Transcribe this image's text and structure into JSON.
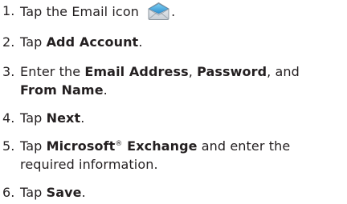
{
  "steps": [
    {
      "number": "1.",
      "parts": [
        {
          "text": "Tap the Email icon ",
          "bold": false
        },
        {
          "icon": "email-envelope-icon"
        },
        {
          "text": ".",
          "bold": false
        }
      ]
    },
    {
      "number": "2.",
      "parts": [
        {
          "text": "Tap ",
          "bold": false
        },
        {
          "text": "Add Account",
          "bold": true
        },
        {
          "text": ".",
          "bold": false
        }
      ]
    },
    {
      "number": "3.",
      "parts": [
        {
          "text": "Enter the ",
          "bold": false
        },
        {
          "text": "Email Address",
          "bold": true
        },
        {
          "text": ", ",
          "bold": false
        },
        {
          "text": "Password",
          "bold": true
        },
        {
          "text": ", and ",
          "bold": false
        },
        {
          "text": "From Name",
          "bold": true
        },
        {
          "text": ".",
          "bold": false
        }
      ]
    },
    {
      "number": "4.",
      "parts": [
        {
          "text": "Tap ",
          "bold": false
        },
        {
          "text": "Next",
          "bold": true
        },
        {
          "text": ".",
          "bold": false
        }
      ]
    },
    {
      "number": "5.",
      "parts": [
        {
          "text": "Tap ",
          "bold": false
        },
        {
          "text": "Microsoft",
          "bold": true
        },
        {
          "sup": "®"
        },
        {
          "text": " Exchange",
          "bold": true
        },
        {
          "text": " and enter the required information.",
          "bold": false
        }
      ]
    },
    {
      "number": "6.",
      "parts": [
        {
          "text": "Tap ",
          "bold": false
        },
        {
          "text": "Save",
          "bold": true
        },
        {
          "text": ".",
          "bold": false
        }
      ]
    }
  ]
}
